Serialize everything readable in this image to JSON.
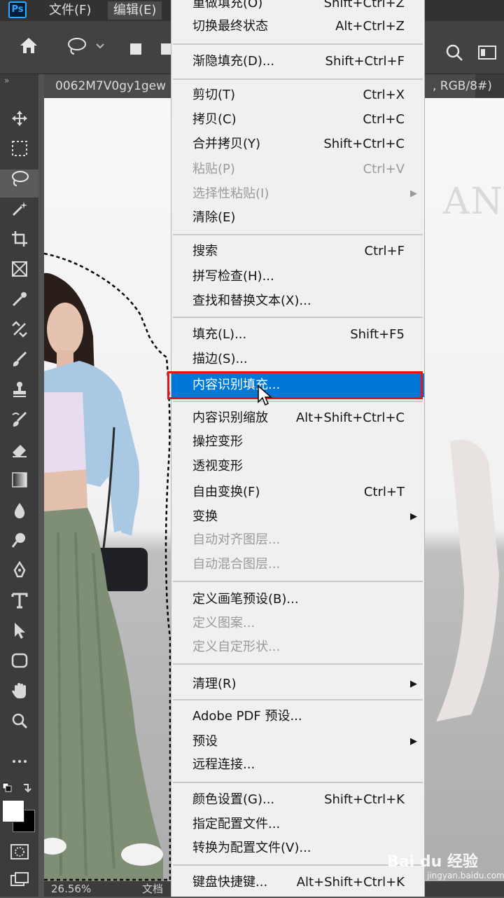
{
  "menubar": {
    "file": "文件(F)",
    "edit": "编辑(E)"
  },
  "tab": {
    "title": "0062M7V0gy1gew",
    "suffix": ", RGB/8#)"
  },
  "canvas": {
    "brand_text": "ANY"
  },
  "status": {
    "zoom": "26.56%",
    "doc": "文档"
  },
  "menu": {
    "items": [
      {
        "label": "重做填充(O)",
        "shortcut": "Shift+Ctrl+Z"
      },
      {
        "label": "切换最终状态",
        "shortcut": "Alt+Ctrl+Z"
      },
      {
        "label": "渐隐填充(D)...",
        "shortcut": "Shift+Ctrl+F"
      },
      {
        "label": "剪切(T)",
        "shortcut": "Ctrl+X"
      },
      {
        "label": "拷贝(C)",
        "shortcut": "Ctrl+C"
      },
      {
        "label": "合并拷贝(Y)",
        "shortcut": "Shift+Ctrl+C"
      },
      {
        "label": "粘贴(P)",
        "shortcut": "Ctrl+V"
      },
      {
        "label": "选择性粘贴(I)",
        "shortcut": ""
      },
      {
        "label": "清除(E)",
        "shortcut": ""
      },
      {
        "label": "搜索",
        "shortcut": "Ctrl+F"
      },
      {
        "label": "拼写检查(H)...",
        "shortcut": ""
      },
      {
        "label": "查找和替换文本(X)...",
        "shortcut": ""
      },
      {
        "label": "填充(L)...",
        "shortcut": "Shift+F5"
      },
      {
        "label": "描边(S)...",
        "shortcut": ""
      },
      {
        "label": "内容识别填充...",
        "shortcut": ""
      },
      {
        "label": "内容识别缩放",
        "shortcut": "Alt+Shift+Ctrl+C"
      },
      {
        "label": "操控变形",
        "shortcut": ""
      },
      {
        "label": "透视变形",
        "shortcut": ""
      },
      {
        "label": "自由变换(F)",
        "shortcut": "Ctrl+T"
      },
      {
        "label": "变换",
        "shortcut": ""
      },
      {
        "label": "自动对齐图层...",
        "shortcut": ""
      },
      {
        "label": "自动混合图层...",
        "shortcut": ""
      },
      {
        "label": "定义画笔预设(B)...",
        "shortcut": ""
      },
      {
        "label": "定义图案...",
        "shortcut": ""
      },
      {
        "label": "定义自定形状...",
        "shortcut": ""
      },
      {
        "label": "清理(R)",
        "shortcut": ""
      },
      {
        "label": "Adobe PDF 预设...",
        "shortcut": ""
      },
      {
        "label": "预设",
        "shortcut": ""
      },
      {
        "label": "远程连接...",
        "shortcut": ""
      },
      {
        "label": "颜色设置(G)...",
        "shortcut": "Shift+Ctrl+K"
      },
      {
        "label": "指定配置文件...",
        "shortcut": ""
      },
      {
        "label": "转换为配置文件(V)...",
        "shortcut": ""
      },
      {
        "label": "键盘快捷键...",
        "shortcut": "Alt+Shift+Ctrl+K"
      }
    ]
  },
  "watermark": {
    "text": "Bai du 经验",
    "sub": "jingyan.baidu.com"
  },
  "colors": {
    "highlight": "#0078d7",
    "highlight_border": "#e3141b",
    "menu_bg": "#f0f0f0"
  }
}
